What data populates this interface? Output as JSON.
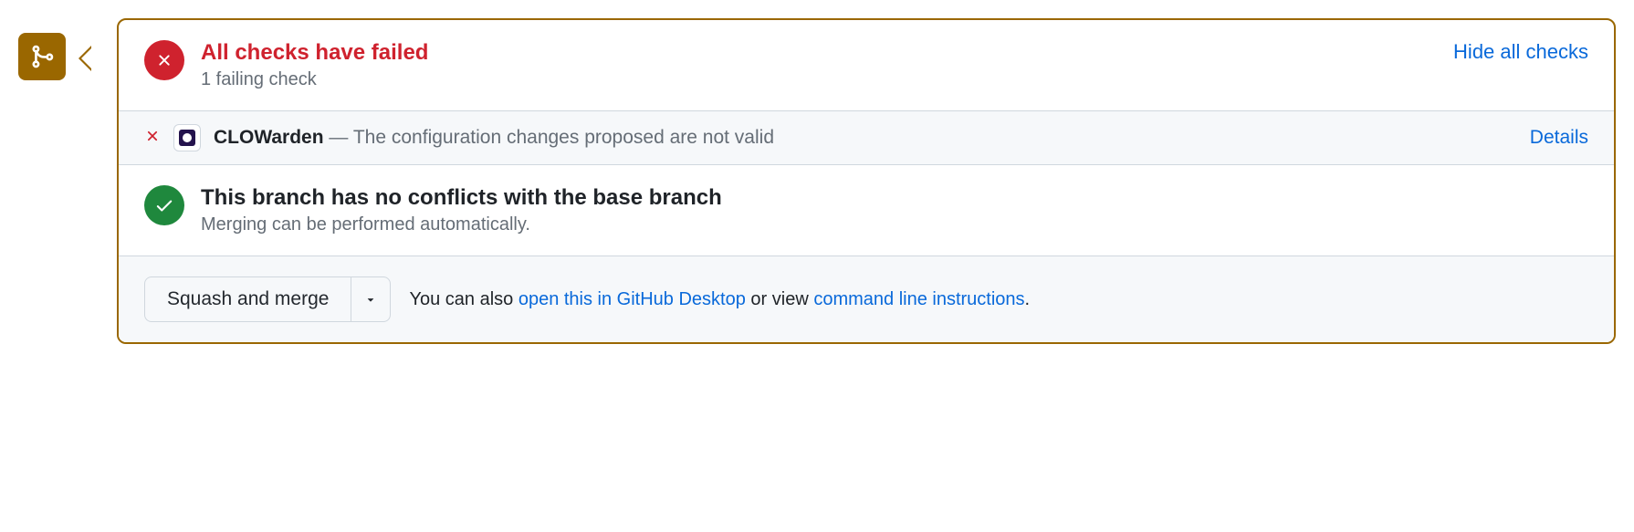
{
  "checks": {
    "title": "All checks have failed",
    "subtitle": "1 failing check",
    "toggle_link": "Hide all checks",
    "items": [
      {
        "name": "CLOWarden",
        "separator": " — ",
        "description": "The configuration changes proposed are not valid",
        "details_link": "Details"
      }
    ]
  },
  "merge_status": {
    "title": "This branch has no conflicts with the base branch",
    "subtitle": "Merging can be performed automatically."
  },
  "actions": {
    "button_label": "Squash and merge",
    "help_prefix": "You can also ",
    "desktop_link": "open this in GitHub Desktop",
    "help_middle": " or view ",
    "cli_link": "command line instructions",
    "help_suffix": "."
  }
}
